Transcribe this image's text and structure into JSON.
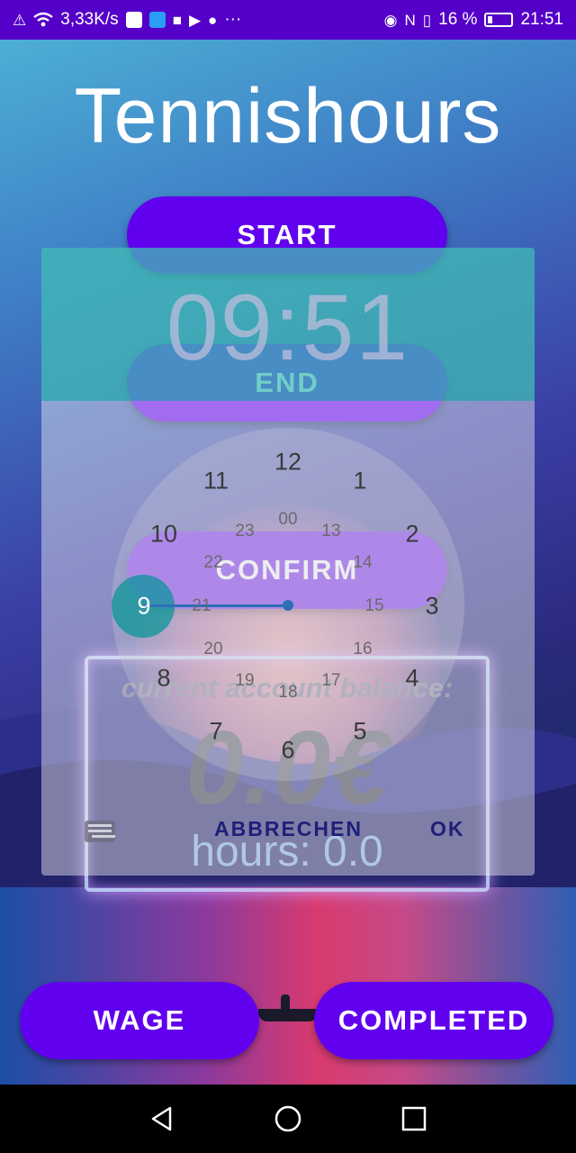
{
  "status_bar": {
    "speed": "3,33K/s",
    "dots": "···",
    "battery_pct": "16 %",
    "time": "21:51"
  },
  "app": {
    "title": "Tennishours"
  },
  "buttons": {
    "start": "START",
    "end": "END",
    "confirm": "CONFIRM",
    "wage": "WAGE",
    "completed": "COMPLETED"
  },
  "balance": {
    "label": "current account balance:",
    "amount": "0.0€",
    "hours": "hours: 0.0"
  },
  "time_picker": {
    "time": "09:51",
    "outer_hours": [
      "12",
      "1",
      "2",
      "3",
      "4",
      "5",
      "6",
      "7",
      "8",
      "9",
      "10",
      "11"
    ],
    "inner_hours": [
      "00",
      "13",
      "14",
      "15",
      "16",
      "17",
      "18",
      "19",
      "20",
      "21",
      "22",
      "23"
    ],
    "cancel": "ABBRECHEN",
    "ok": "OK"
  },
  "colors": {
    "accent": "#6100ee",
    "status_bar": "#5400c8"
  },
  "icons": {
    "alert": "alert-icon",
    "wifi": "wifi-icon",
    "eye": "eye-icon",
    "nfc": "nfc-icon",
    "vibrate": "vibrate-icon",
    "battery": "battery-icon",
    "keyboard": "keyboard-icon",
    "back": "back-icon",
    "home": "home-icon",
    "recents": "recents-icon"
  }
}
